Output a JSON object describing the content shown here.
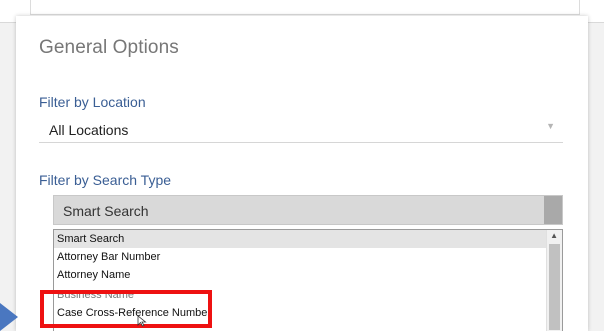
{
  "section_title": "General Options",
  "filters": {
    "location": {
      "label": "Filter by Location",
      "value": "All Locations"
    },
    "search_type": {
      "label": "Filter by Search Type",
      "value": "Smart Search",
      "options": [
        "Smart Search",
        "Attorney Bar Number",
        "Attorney Name",
        "Business Name",
        "Case Cross-Reference Number"
      ]
    }
  },
  "colors": {
    "label_blue": "#3a5e94",
    "highlight_red": "#ee1111",
    "arrow_blue": "#4a77c0"
  },
  "icons": {
    "dropdown_caret": "▼",
    "scroll_up": "▲"
  }
}
